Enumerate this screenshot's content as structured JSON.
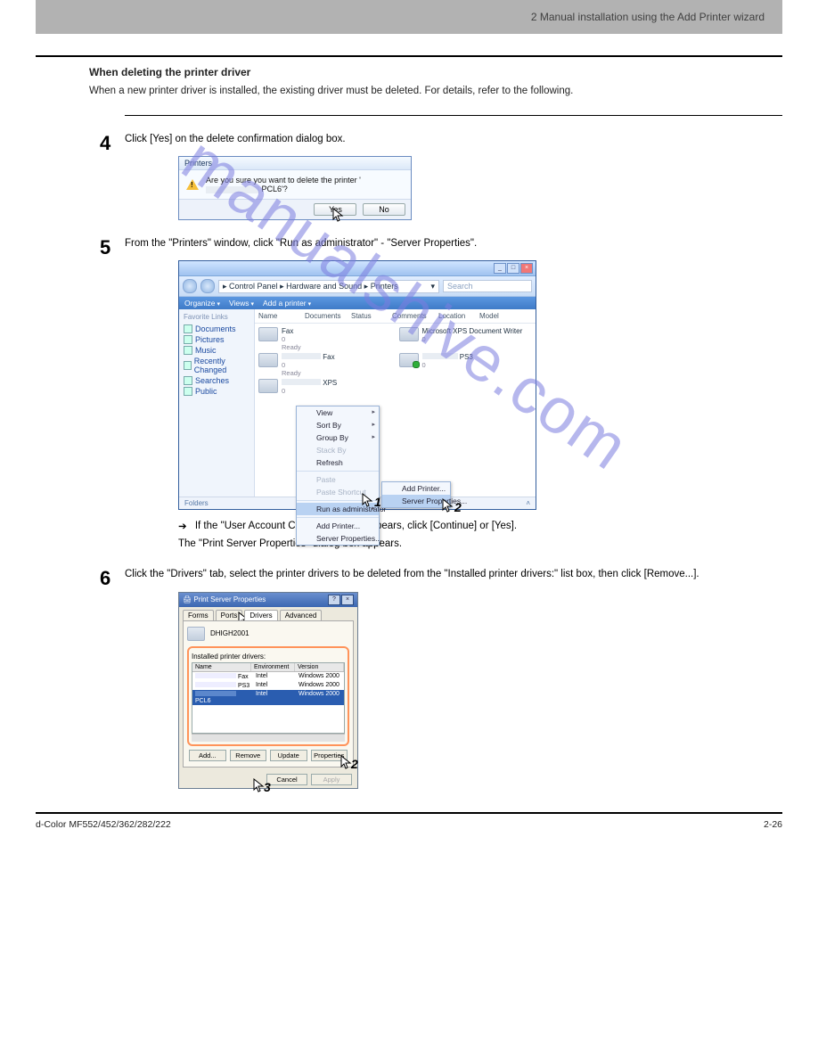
{
  "running_head": "2   Manual installation using the Add Printer wizard",
  "header_title": "When deleting the printer driver",
  "header_body": "When a new printer driver is installed, the existing driver must be deleted. For details, refer to the following.",
  "steps": {
    "s4": {
      "text": "Click [Yes] on the delete confirmation dialog box."
    },
    "s5": {
      "line1": "From the \"Printers\" window, click \"Run as administrator\" - \"Server Properties\".",
      "note_line1": "If the \"User Account Control\" window appears, click [Continue] or [Yes].",
      "note_line2": "The \"Print Server Properties\" dialog box appears."
    },
    "s6": {
      "text": "Click the \"Drivers\" tab, select the printer drivers to be deleted from the \"Installed printer drivers:\" list box, then click [Remove...]."
    }
  },
  "dialog": {
    "title": "Printers",
    "message_prefix": "Are you sure you want to delete the printer '",
    "message_suffix": "PCL6'?",
    "yes": "Yes",
    "no": "No"
  },
  "explorer": {
    "crumb_a": "Control Panel",
    "crumb_b": "Hardware and Sound",
    "crumb_c": "Printers",
    "search_placeholder": "Search",
    "toolbar": {
      "organize": "Organize",
      "views": "Views",
      "add": "Add a printer"
    },
    "side_header": "Favorite Links",
    "side": [
      "Documents",
      "Pictures",
      "Music",
      "Recently Changed",
      "Searches",
      "Public"
    ],
    "cols": [
      "Name",
      "Documents",
      "Status",
      "Comments",
      "Location",
      "Model"
    ],
    "printers": {
      "fax_name": "Fax",
      "fax_docs": "0",
      "fax_status": "Ready",
      "xps_name": "Microsoft XPS Document Writer",
      "xps_docs": "0",
      "fax2_name": "Fax",
      "fax2_docs": "0",
      "fax2_status": "Ready",
      "ps3_name": "PS3",
      "ps3_docs": "0",
      "xps2_name": "XPS",
      "xps2_docs": "0"
    },
    "ctx": {
      "view": "View",
      "sort": "Sort By",
      "group": "Group By",
      "stack": "Stack By",
      "refresh": "Refresh",
      "paste": "Paste",
      "paste_sc": "Paste Shortcut",
      "runas": "Run as administrator",
      "addp": "Add Printer...",
      "srvp": "Server Properties..."
    },
    "sub": {
      "addp": "Add Printer...",
      "srvp": "Server Properties..."
    },
    "footer_left": "Folders"
  },
  "psp": {
    "title": "Print Server Properties",
    "tabs": [
      "Forms",
      "Ports",
      "Drivers",
      "Advanced"
    ],
    "hostname": "DHIGH2001",
    "list_label": "Installed printer drivers:",
    "headers": [
      "Name",
      "Environment",
      "Version"
    ],
    "rows": [
      {
        "name": "Fax",
        "env": "Intel",
        "ver": "Windows 2000"
      },
      {
        "name": "PS3",
        "env": "Intel",
        "ver": "Windows 2000"
      },
      {
        "name": "PCL6",
        "env": "Intel",
        "ver": "Windows 2000"
      }
    ],
    "buttons": {
      "add": "Add...",
      "remove": "Remove",
      "update": "Update",
      "prop": "Properties"
    },
    "foot": {
      "cancel": "Cancel",
      "apply": "Apply"
    }
  },
  "watermark": "manualshive.com",
  "footer": {
    "left": "d-Color MF552/452/362/282/222",
    "right": "2-26"
  },
  "labels": {
    "n1": "1",
    "n2": "2",
    "n3": "3"
  }
}
